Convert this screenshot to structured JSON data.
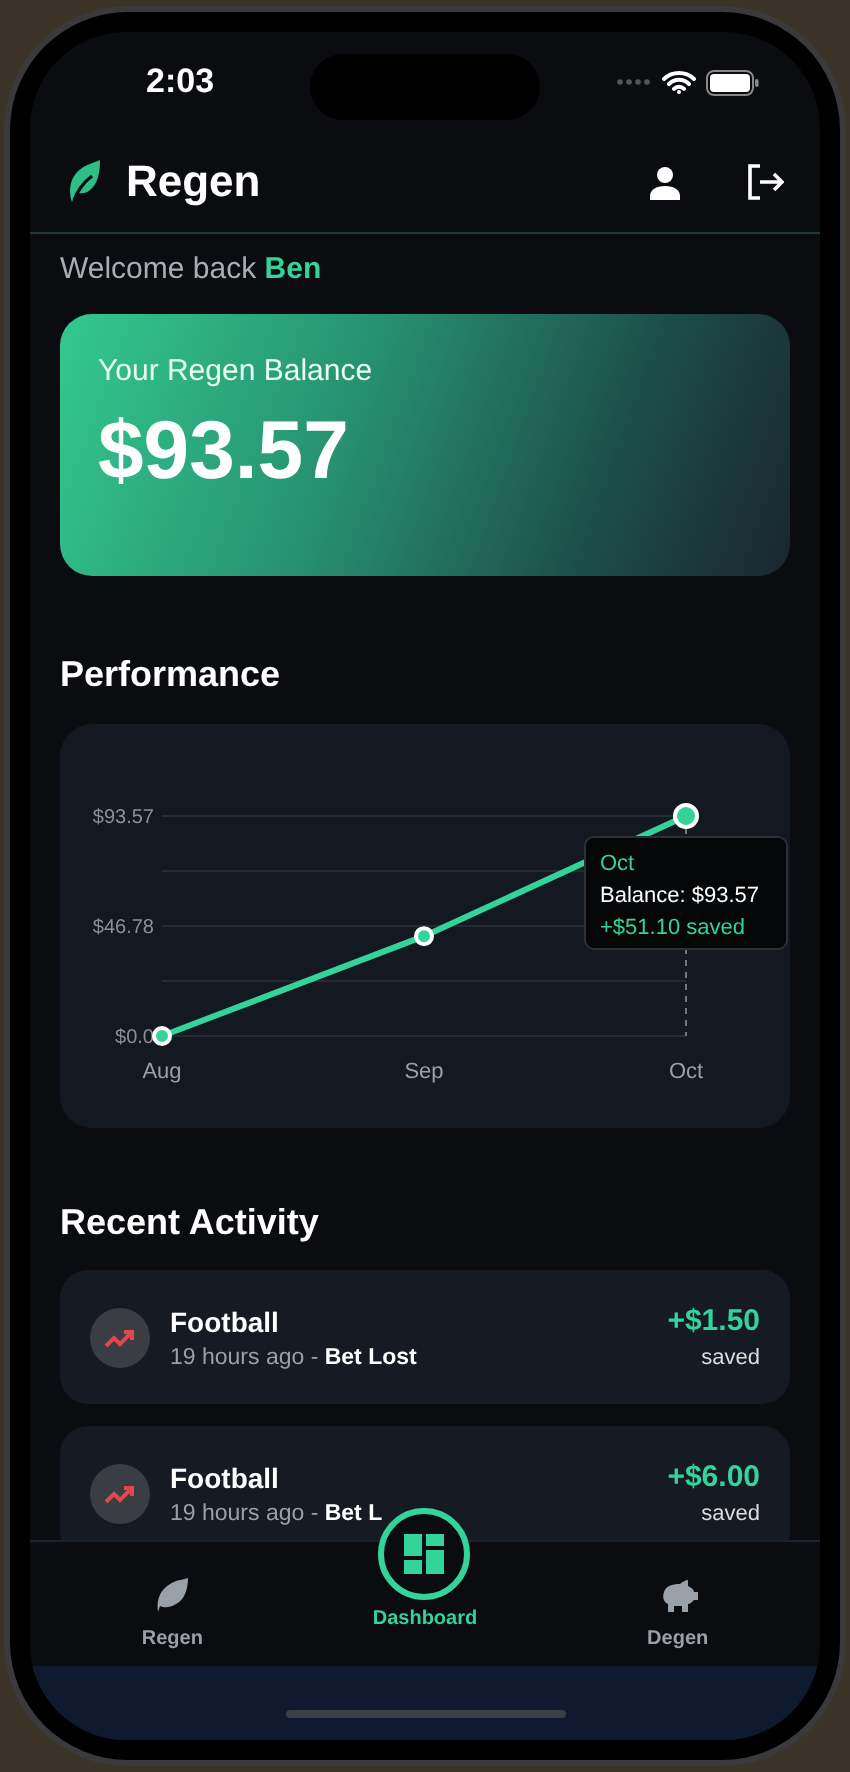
{
  "status_bar": {
    "time": "2:03"
  },
  "header": {
    "title": "Regen"
  },
  "welcome": "Welcome back **Ben**",
  "balance": {
    "label": "Your Regen Balance",
    "amount": "$93.57"
  },
  "performance": {
    "title": "Performance",
    "chart_data": {
      "type": "line",
      "categories": [
        "Aug",
        "Sep",
        "Oct"
      ],
      "series": [
        {
          "color": "#34d399",
          "marker": "circle",
          "values": [
            0,
            42.47,
            93.57
          ]
        }
      ],
      "ylim": [
        0,
        93.57
      ],
      "yticks": [
        {
          "value": 0,
          "label": "$0.0"
        },
        {
          "value": 46.78,
          "label": "$46.78"
        },
        {
          "value": 93.57,
          "label": "$93.57"
        }
      ]
    },
    "tooltip": {
      "title": "Oct",
      "balance": "Balance: $93.57",
      "saved": "+$51.10 saved"
    }
  },
  "activity": {
    "title": "Recent Activity",
    "items": [
      {
        "title": "Football",
        "subtitle": "19 hours ago - **Bet Lost**",
        "amount": "+$1.50",
        "note": "saved"
      },
      {
        "title": "Football",
        "subtitle": "19 hours ago - **Bet L**",
        "amount": "+$6.00",
        "note": "saved"
      }
    ]
  },
  "tabs": [
    {
      "kind": "leaf",
      "label": "Regen",
      "selected": false
    },
    {
      "kind": "dashboard",
      "label": "Dashboard",
      "selected": true
    },
    {
      "kind": "piggy",
      "label": "Degen",
      "selected": false
    }
  ]
}
